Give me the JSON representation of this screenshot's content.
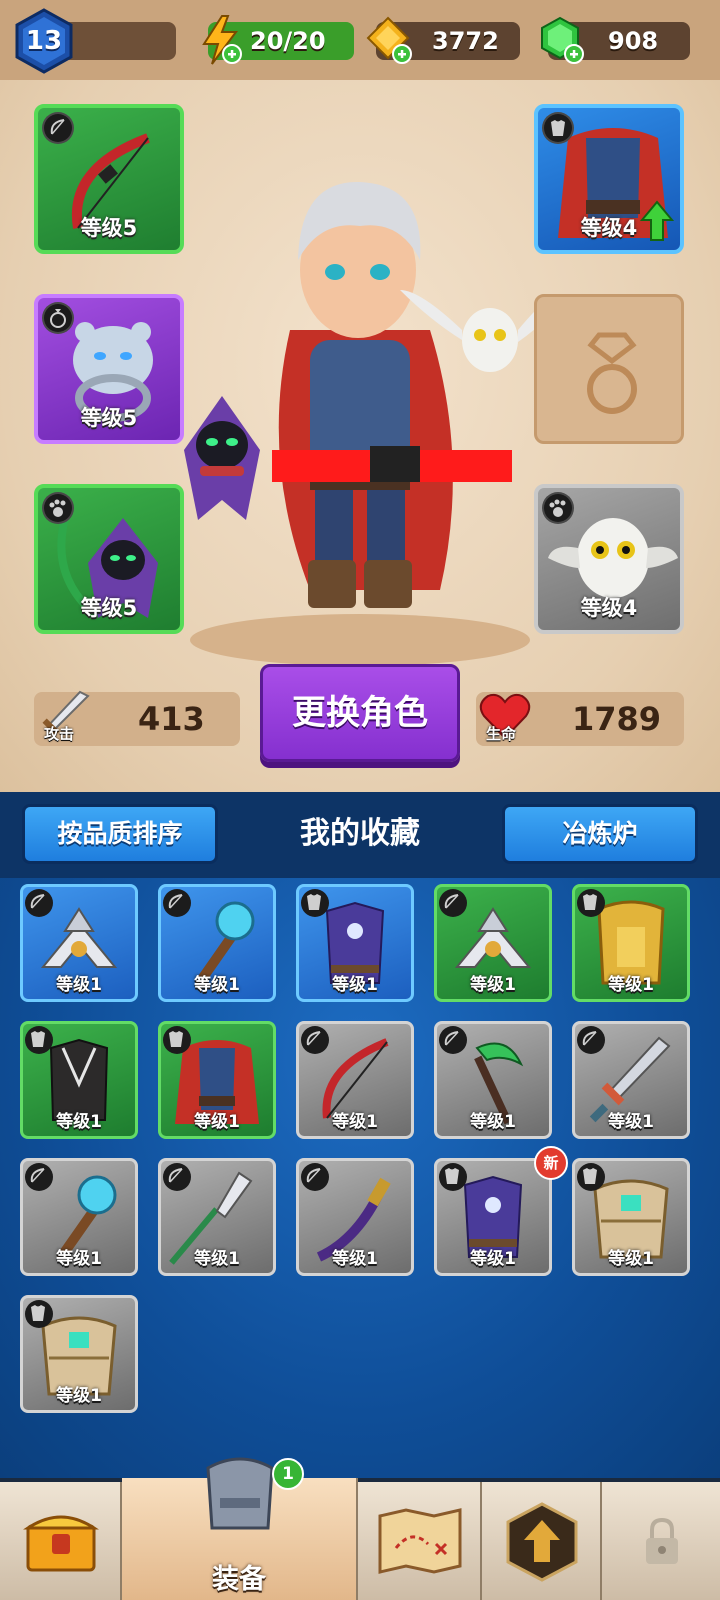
{
  "header": {
    "player_level": "13",
    "energy": "20/20",
    "gold": "3772",
    "gems": "908"
  },
  "equipped": {
    "weapon": {
      "level_label": "等级5",
      "category": "bow-icon"
    },
    "armor": {
      "level_label": "等级4",
      "category": "armor-icon"
    },
    "ring": {
      "level_label": "等级5",
      "category": "ring-icon"
    },
    "ring_slot_empty": {
      "category": "ring-slot-icon"
    },
    "pet_left": {
      "level_label": "等级5",
      "category": "paw-icon"
    },
    "pet_right": {
      "level_label": "等级4",
      "category": "paw-icon"
    }
  },
  "stats": {
    "attack_label": "攻击",
    "attack_value": "413",
    "hp_label": "生命",
    "hp_value": "1789"
  },
  "change_hero_label": "更换角色",
  "collection": {
    "sort_button": "按品质排序",
    "title": "我的收藏",
    "forge_button": "冶炼炉"
  },
  "inventory": [
    {
      "level": "等级1",
      "rarity": "blue",
      "category": "bow-icon",
      "art": "shuriken"
    },
    {
      "level": "等级1",
      "rarity": "blue",
      "category": "bow-icon",
      "art": "staff"
    },
    {
      "level": "等级1",
      "rarity": "blue",
      "category": "armor-icon",
      "art": "robe"
    },
    {
      "level": "等级1",
      "rarity": "green",
      "category": "bow-icon",
      "art": "shuriken"
    },
    {
      "level": "等级1",
      "rarity": "green",
      "category": "armor-icon",
      "art": "gold-armor"
    },
    {
      "level": "等级1",
      "rarity": "green",
      "category": "armor-icon",
      "art": "dark-robe"
    },
    {
      "level": "等级1",
      "rarity": "green",
      "category": "armor-icon",
      "art": "cape"
    },
    {
      "level": "等级1",
      "rarity": "grey",
      "category": "bow-icon",
      "art": "bow"
    },
    {
      "level": "等级1",
      "rarity": "grey",
      "category": "bow-icon",
      "art": "scythe"
    },
    {
      "level": "等级1",
      "rarity": "grey",
      "category": "bow-icon",
      "art": "sword"
    },
    {
      "level": "等级1",
      "rarity": "grey",
      "category": "bow-icon",
      "art": "staff"
    },
    {
      "level": "等级1",
      "rarity": "grey",
      "category": "bow-icon",
      "art": "spear"
    },
    {
      "level": "等级1",
      "rarity": "grey",
      "category": "bow-icon",
      "art": "katana"
    },
    {
      "level": "等级1",
      "rarity": "grey",
      "category": "armor-icon",
      "art": "robe",
      "new_label": "新"
    },
    {
      "level": "等级1",
      "rarity": "grey",
      "category": "armor-icon",
      "art": "plate"
    },
    {
      "level": "等级1",
      "rarity": "grey",
      "category": "armor-icon",
      "art": "plate"
    }
  ],
  "nav": {
    "equipment_label": "装备",
    "equipment_badge": "1"
  },
  "colors": {
    "rarity_green": "#3bb04a",
    "rarity_blue": "#2f8de8",
    "rarity_purple": "#a24ee0",
    "rarity_grey": "#8a8a8a",
    "button_purple": "#9440dc",
    "button_blue": "#2c92ea"
  }
}
